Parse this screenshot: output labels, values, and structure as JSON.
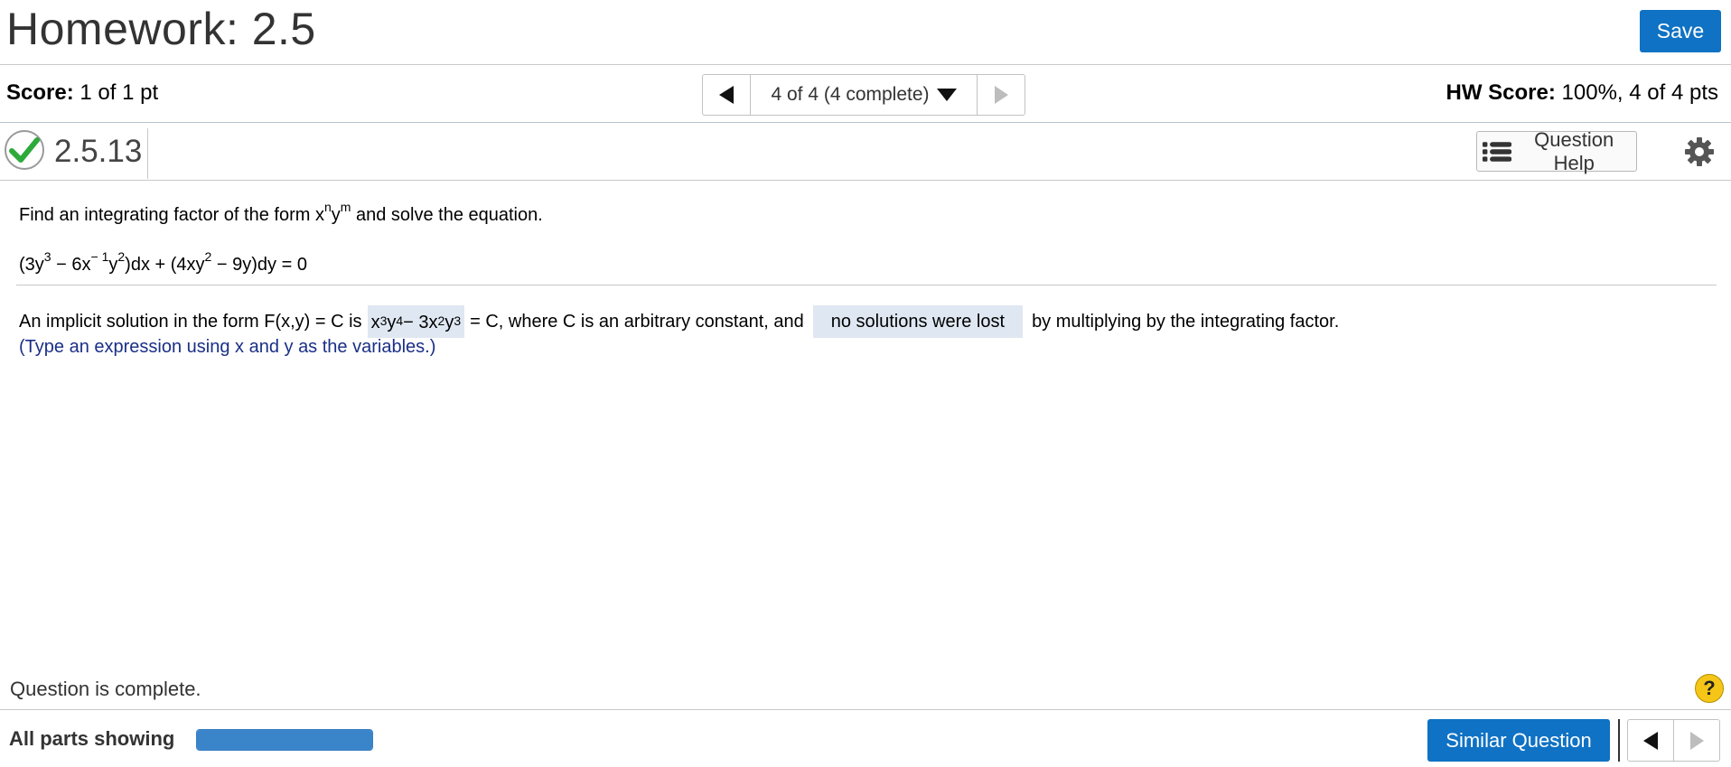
{
  "header": {
    "title": "Homework: 2.5",
    "save_label": "Save"
  },
  "score_bar": {
    "score_label": "Score:",
    "score_value": "1 of 1 pt",
    "nav_label": "4 of 4 (4 complete)",
    "hw_score_label": "HW Score:",
    "hw_score_value": "100%, 4 of 4 pts"
  },
  "question_bar": {
    "question_number": "2.5.13",
    "help_label": "Question Help",
    "status": "correct"
  },
  "question": {
    "intro_prefix": "Find an integrating factor of the form x",
    "intro_sup_n": "n",
    "intro_mid": "y",
    "intro_sup_m": "m",
    "intro_suffix": " and solve the equation.",
    "eq": {
      "p1": "(3y",
      "s1": "3",
      "p2": " − 6x",
      "s2": "− 1",
      "p3": "y",
      "s3": "2",
      "p4": ")dx + (4xy",
      "s4": "2",
      "p5": " − 9y)dy = 0"
    },
    "answer_prefix": "An implicit solution in the form F(x,y) = C is",
    "answer_expr": {
      "a1": "x",
      "a1s": "3",
      "a2": "y",
      "a2s": "4",
      "a3": " − 3x",
      "a3s": "2",
      "a4": "y",
      "a4s": "3"
    },
    "answer_mid": "= C, where C is an arbitrary constant, and",
    "dropdown_value": "no solutions were lost",
    "answer_suffix": "by multiplying by the integrating factor.",
    "hint": "(Type an expression using x and y as the variables.)"
  },
  "footer": {
    "status_text": "Question is complete.",
    "all_parts_label": "All parts showing",
    "progress_fraction": 1.0,
    "similar_label": "Similar Question"
  },
  "colors": {
    "accent": "#0f72c4",
    "check": "#2eaa3b",
    "hint": "#1a2f86",
    "answer_bg": "#dfe7f2"
  }
}
